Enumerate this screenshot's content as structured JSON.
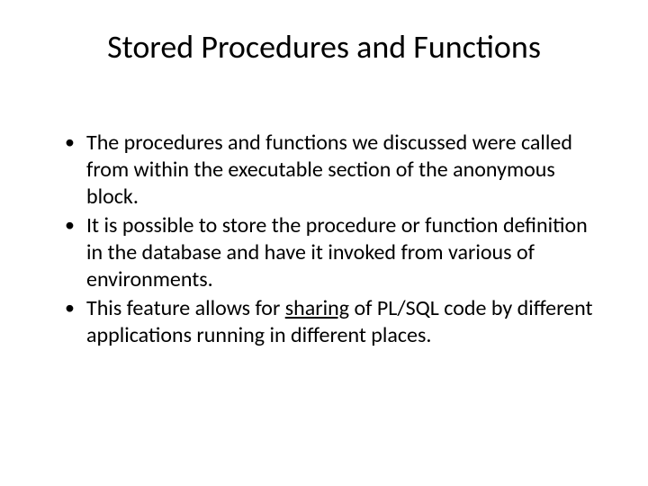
{
  "slide": {
    "title": "Stored Procedures and Functions",
    "bullets": [
      {
        "prefix": "The procedures and functions we discussed were called from within the executable section of the anonymous block.",
        "underlined": "",
        "suffix": ""
      },
      {
        "prefix": "It is possible to store the procedure or function definition in the database and have it invoked from various of environments.",
        "underlined": "",
        "suffix": ""
      },
      {
        "prefix": "This feature allows for ",
        "underlined": "sharing",
        "suffix": " of PL/SQL code by different applications running in different places."
      }
    ]
  }
}
